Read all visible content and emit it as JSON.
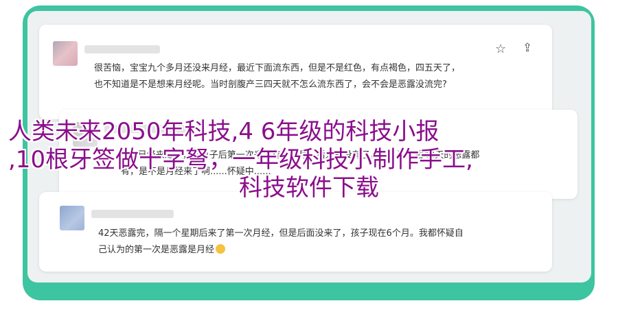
{
  "comments": [
    {
      "text_line1": "很苦恼，宝宝九个多月还没来月经，最近下面流东西，但是不是红色，有点褐色，四五天了，",
      "text_line2": "也不知道是不是想来月经呢。当时剖腹产三四天就不怎么流东西了，会不会是恶露没流完?"
    },
    {
      "text_line1": "......已经来过了，出月子后第一次来了有一个月，后来就没有了，有人说产后42天的恶露都",
      "text_line2": "有，是不是月经来了啊......怀疑中......"
    },
    {
      "text_line1": "42天恶露完，隔一个星期后来了第一次月经，但是后面没来了，孩子现在6个月。我都怀疑自",
      "text_line2": "己认为的第一次是恶露是月经"
    }
  ],
  "icons": {
    "star": "star-icon",
    "share": "share-icon",
    "emoji": "emoji-icon"
  },
  "overlay": {
    "line1": "人类未来2050年科技,4 6年级的科技小报",
    "line2": ",10根牙签做十字弩，一年级科技小制作手工,",
    "line3": "科技软件下载"
  },
  "colors": {
    "frame": "#3dc4a0",
    "overlay_text": "#8a0f8c"
  }
}
